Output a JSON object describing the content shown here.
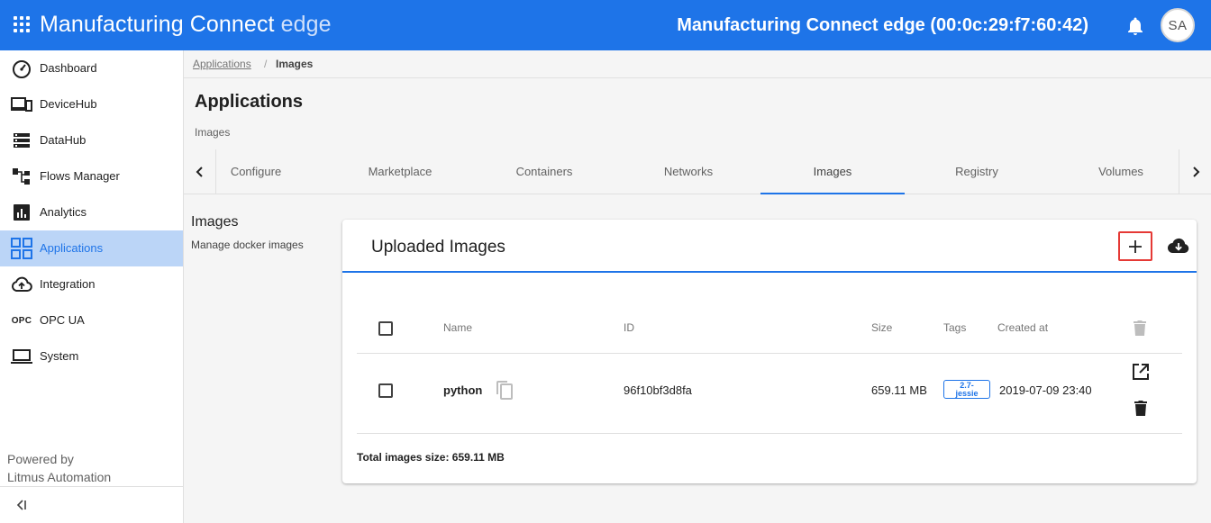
{
  "header": {
    "app_name": "Manufacturing Connect",
    "app_suffix": "edge",
    "device_title": "Manufacturing Connect edge (00:0c:29:f7:60:42)",
    "avatar_initials": "SA",
    "brand_color": "#1e74e8"
  },
  "sidebar": {
    "items": [
      {
        "label": "Dashboard",
        "icon": "speedometer-icon"
      },
      {
        "label": "DeviceHub",
        "icon": "devices-icon"
      },
      {
        "label": "DataHub",
        "icon": "storage-icon"
      },
      {
        "label": "Flows Manager",
        "icon": "flow-icon"
      },
      {
        "label": "Analytics",
        "icon": "analytics-icon"
      },
      {
        "label": "Applications",
        "icon": "apps-grid-icon",
        "active": true
      },
      {
        "label": "Integration",
        "icon": "cloud-upload-icon"
      },
      {
        "label": "OPC UA",
        "icon": "opc-icon",
        "icon_text": "OPC"
      },
      {
        "label": "System",
        "icon": "laptop-icon"
      }
    ],
    "powered_by": "Powered by",
    "company": "Litmus Automation"
  },
  "breadcrumb": {
    "parent": "Applications",
    "separator": "/",
    "current": "Images"
  },
  "page": {
    "title": "Applications",
    "subtitle": "Images"
  },
  "tabs": [
    "Configure",
    "Marketplace",
    "Containers",
    "Networks",
    "Images",
    "Registry",
    "Volumes"
  ],
  "active_tab": "Images",
  "section": {
    "title": "Images",
    "description": "Manage docker images"
  },
  "card": {
    "title": "Uploaded Images",
    "columns": {
      "name": "Name",
      "id": "ID",
      "size": "Size",
      "tags": "Tags",
      "created": "Created at"
    },
    "rows": [
      {
        "name": "python",
        "id": "96f10bf3d8fa",
        "size": "659.11 MB",
        "tag_line1": "2.7-",
        "tag_line2": "jessie",
        "created": "2019-07-09 23:40"
      }
    ],
    "total_label": "Total images size: 659.11 MB"
  }
}
